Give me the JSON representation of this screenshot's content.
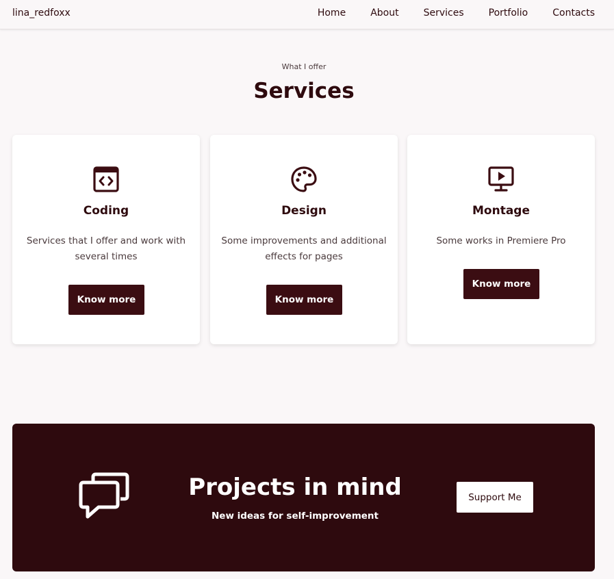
{
  "header": {
    "logo": "lina_redfoxx",
    "nav": [
      "Home",
      "About",
      "Services",
      "Portfolio",
      "Contacts"
    ]
  },
  "services": {
    "subtitle": "What I offer",
    "title": "Services",
    "cards": [
      {
        "icon": "code-window-icon",
        "title": "Coding",
        "description": "Services that I offer and work with several times",
        "button": "Know more"
      },
      {
        "icon": "palette-icon",
        "title": "Design",
        "description": "Some improvements and additional effects for pages",
        "button": "Know more"
      },
      {
        "icon": "monitor-play-icon",
        "title": "Montage",
        "description": "Some works in Premiere Pro",
        "button": "Know more"
      }
    ]
  },
  "banner": {
    "icon": "chat-bubbles-icon",
    "title": "Projects in mind",
    "subtitle": "New ideas for self-improvement",
    "button": "Support Me"
  },
  "colors": {
    "accent": "#3b0d12",
    "banner_bg": "#2e0a0e",
    "page_bg": "#faf7f8"
  }
}
